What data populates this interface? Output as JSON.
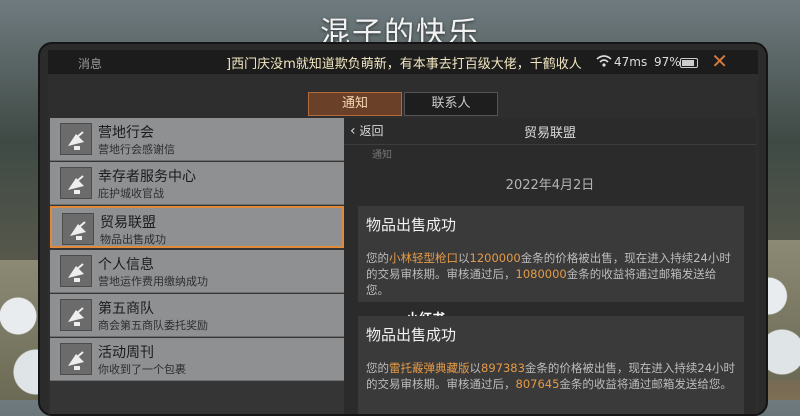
{
  "overlay_title": "混子的快乐",
  "status": {
    "label": "消息",
    "ticker": "]西门庆没m就知道欺负萌新，有本事去打百级大佬，千鹤收人",
    "ping": "47ms",
    "battery": "97%",
    "close": "✕"
  },
  "tabs": {
    "notice": "通知",
    "contacts": "联系人"
  },
  "list": [
    {
      "title": "营地行会",
      "subtitle": "营地行会感谢信"
    },
    {
      "title": "幸存者服务中心",
      "subtitle": "庇护城收官战"
    },
    {
      "title": "贸易联盟",
      "subtitle": "物品出售成功",
      "selected": true
    },
    {
      "title": "个人信息",
      "subtitle": "营地运作费用缴纳成功"
    },
    {
      "title": "第五商队",
      "subtitle": "商会第五商队委托奖励"
    },
    {
      "title": "活动周刊",
      "subtitle": "你收到了一个包裹"
    }
  ],
  "detail": {
    "back": "返回",
    "title": "贸易联盟",
    "cut_text": "通知",
    "date": "2022年4月2日",
    "watermark": "小红书",
    "cards": [
      {
        "title": "物品出售成功",
        "pre": "您的",
        "item": "小林轻型枪口",
        "mid1": "以",
        "price": "1200000",
        "mid2": "金条的价格被出售，现在进入持续24小时的交易审核期。审核通过后，",
        "income": "1080000",
        "post": "金条的收益将通过邮箱发送给您。"
      },
      {
        "title": "物品出售成功",
        "pre": "您的",
        "item": "雷托霰弹典藏版",
        "mid1": "以",
        "price": "897383",
        "mid2": "金条的价格被出售，现在进入持续24小时的交易审核期。审核通过后，",
        "income": "807645",
        "post": "金条的收益将通过邮箱发送给您。"
      }
    ]
  }
}
